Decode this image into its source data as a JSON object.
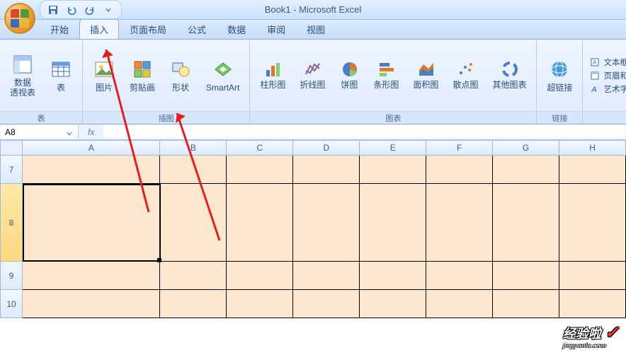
{
  "title": "Book1 - Microsoft Excel",
  "qat": {
    "save": "save",
    "undo": "undo",
    "redo": "redo"
  },
  "tabs": [
    {
      "id": "home",
      "label": "开始"
    },
    {
      "id": "insert",
      "label": "插入"
    },
    {
      "id": "pagelayout",
      "label": "页面布局"
    },
    {
      "id": "formulas",
      "label": "公式"
    },
    {
      "id": "data",
      "label": "数据"
    },
    {
      "id": "review",
      "label": "审阅"
    },
    {
      "id": "view",
      "label": "视图"
    }
  ],
  "active_tab": "insert",
  "ribbon": {
    "tables": {
      "label": "表",
      "pivot": "数据\n透视表",
      "table": "表"
    },
    "illustrations": {
      "label": "插图",
      "picture": "图片",
      "clipart": "剪贴画",
      "shapes": "形状",
      "smartart": "SmartArt"
    },
    "charts": {
      "label": "图表",
      "column": "柱形图",
      "line": "折线图",
      "pie": "饼图",
      "bar": "条形图",
      "area": "面积图",
      "scatter": "散点图",
      "other": "其他图表"
    },
    "links": {
      "label": "链接",
      "hyperlink": "超链接"
    },
    "text": {
      "textbox": "文本框",
      "headerfooter": "页眉和页",
      "wordart": "艺术字"
    }
  },
  "namebox": "A8",
  "fx_label": "fx",
  "columns": [
    "A",
    "B",
    "C",
    "D",
    "E",
    "F",
    "G",
    "H"
  ],
  "rows": [
    "7",
    "8",
    "9",
    "10"
  ],
  "selected_cell": "A8",
  "watermark": {
    "main": "经验啦",
    "sub": "jingyanla.com"
  }
}
